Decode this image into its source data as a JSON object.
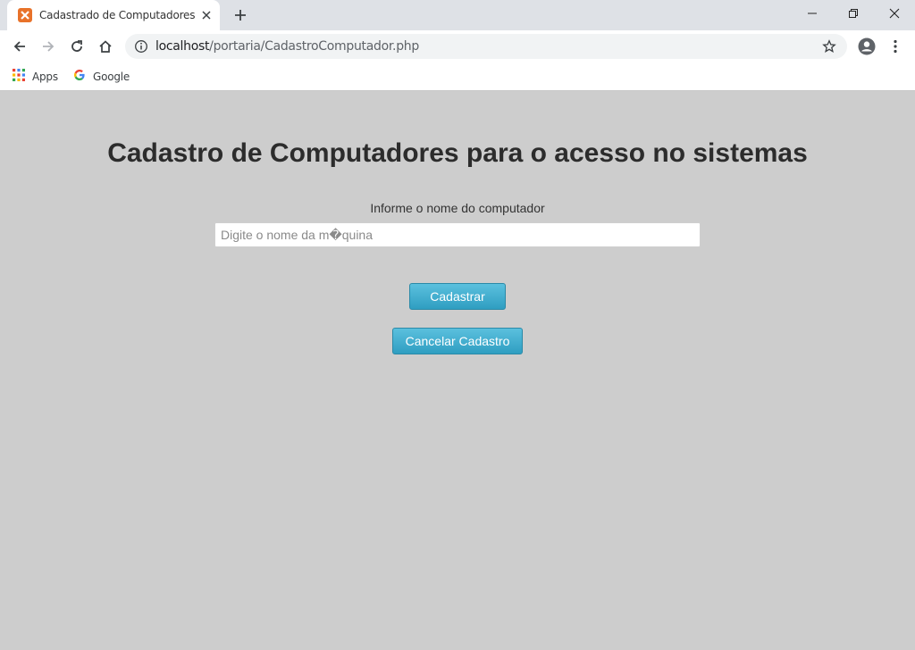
{
  "browser": {
    "tab_title": "Cadastrado de Computadores",
    "url_host": "localhost",
    "url_path": "/portaria/CadastroComputador.php",
    "bookmarks": [
      {
        "label": "Apps",
        "icon": "apps-grid-icon"
      },
      {
        "label": "Google",
        "icon": "google-g-icon"
      }
    ]
  },
  "page": {
    "title": "Cadastro de Computadores para o acesso no sistemas",
    "field_label": "Informe o nome do computador",
    "input_placeholder": "Digite o nome da m�quina",
    "input_value": "",
    "save_label": "Cadastrar",
    "cancel_label": "Cancelar Cadastro"
  },
  "colors": {
    "page_background": "#cdcdcd",
    "button_top": "#5bc0de",
    "button_bottom": "#2f9ec1",
    "favicon": "#e8722a"
  }
}
